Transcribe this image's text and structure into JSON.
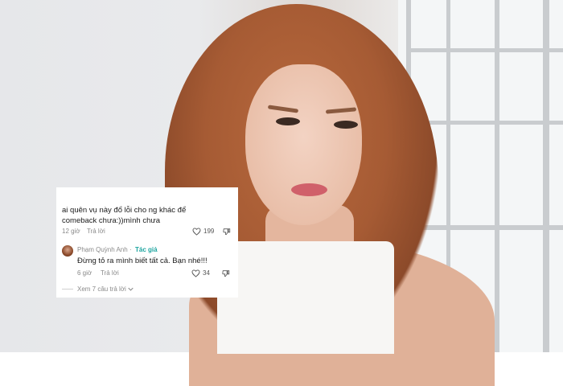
{
  "comment": {
    "line1": "ai quên vụ      này đổ lỗi cho ng khác để",
    "line2": "comeback chưa:))mình chưa",
    "time": "12 giờ",
    "reply_label": "Trả lời",
    "likes": "199"
  },
  "reply": {
    "author": "Phạm Quỳnh Anh",
    "separator": "·",
    "author_tag": "Tác giả",
    "text": "Đừng tỏ ra mình biết tất cả. Bạn nhé!!!",
    "time": "6 giờ",
    "reply_label": "Trả lời",
    "likes": "34"
  },
  "view_more": "Xem 7 câu trả lời",
  "colors": {
    "author_tag": "#1ea5a0",
    "meta_text": "#8a8a8a",
    "body_text": "#1a1a1a"
  },
  "icons": [
    "heart-outline-icon",
    "thumb-down-outline-icon",
    "chevron-down-icon"
  ]
}
